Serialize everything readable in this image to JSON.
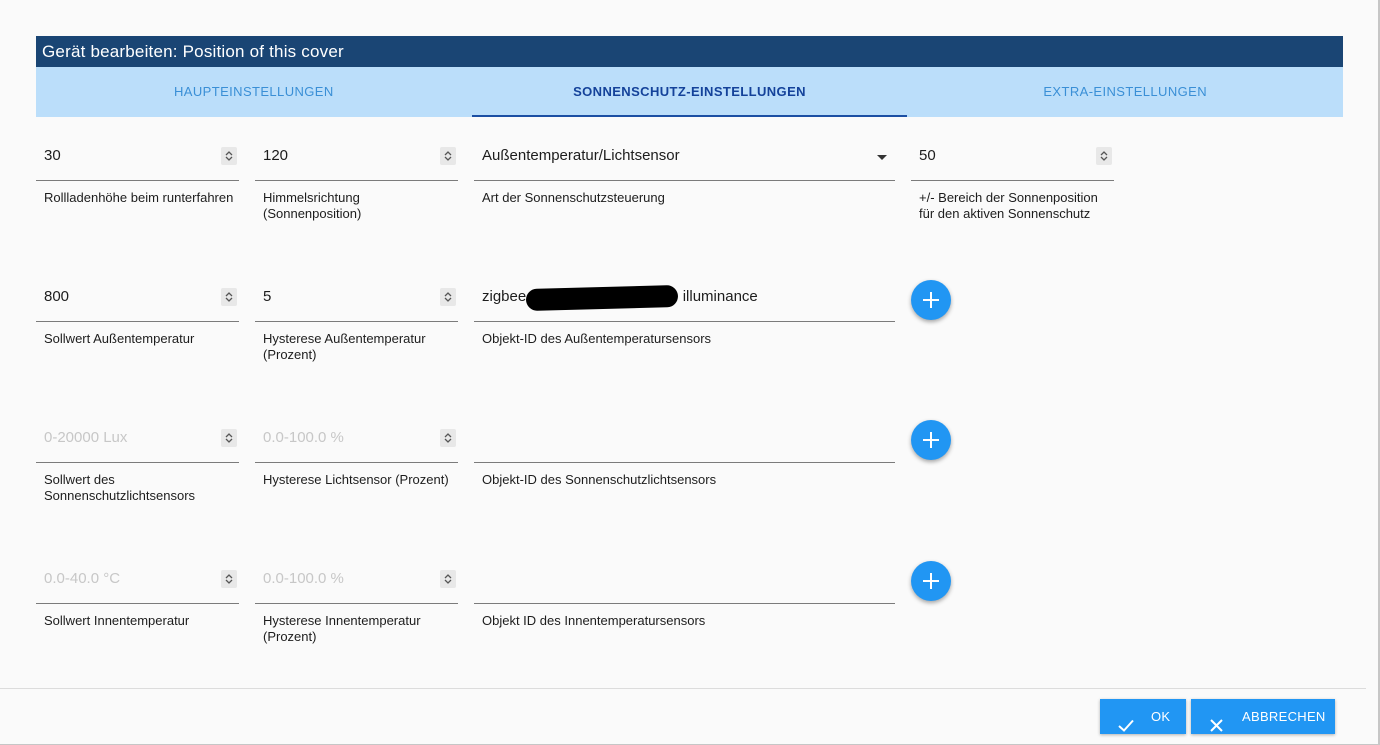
{
  "dialog": {
    "title": "Gerät bearbeiten: Position of this cover"
  },
  "tabs": [
    {
      "label": "HAUPTEINSTELLUNGEN",
      "active": false
    },
    {
      "label": "SONNENSCHUTZ-EINSTELLUNGEN",
      "active": true
    },
    {
      "label": "EXTRA-EINSTELLUNGEN",
      "active": false
    }
  ],
  "fields": {
    "shutter_height": {
      "value": "30",
      "label": "Rollladenhöhe beim runterfahren"
    },
    "sky_direction": {
      "value": "120",
      "label": "Himmelsrichtung (Sonnenposition)"
    },
    "sun_control_type": {
      "value": "Außentemperatur/Lichtsensor",
      "label": "Art der Sonnenschutzsteuerung"
    },
    "sun_range": {
      "value": "50",
      "label": "+/- Bereich der Sonnenposition für den aktiven Sonnenschutz"
    },
    "outside_temp_setpoint": {
      "value": "800",
      "label": "Sollwert Außentemperatur"
    },
    "outside_temp_hysteresis": {
      "value": "5",
      "label": "Hysterese Außentemperatur (Prozent)"
    },
    "outside_temp_sensor": {
      "value_prefix": "zigbee.0",
      "value_suffix": "illuminance",
      "label": "Objekt-ID des Außentemperatursensors"
    },
    "light_sensor_setpoint": {
      "placeholder": "0-20000 Lux",
      "label": "Sollwert des Sonnenschutzlichtsensors"
    },
    "light_sensor_hysteresis": {
      "placeholder": "0.0-100.0 %",
      "label": "Hysterese Lichtsensor (Prozent)"
    },
    "light_sensor_id": {
      "value": "",
      "label": "Objekt-ID des Sonnenschutzlichtsensors"
    },
    "inside_temp_setpoint": {
      "placeholder": "0.0-40.0 °C",
      "label": "Sollwert Innentemperatur"
    },
    "inside_temp_hysteresis": {
      "placeholder": "0.0-100.0 %",
      "label": "Hysterese Innentemperatur (Prozent)"
    },
    "inside_temp_sensor": {
      "value": "",
      "label": "Objekt ID des Innentemperatursensors"
    }
  },
  "buttons": {
    "ok": "OK",
    "cancel": "ABBRECHEN"
  },
  "colors": {
    "title_bg": "#1a4574",
    "tabs_bg": "#bbdefa",
    "accent": "#2196f3",
    "active_tab_text": "#14429a"
  },
  "icons": {
    "add": "plus-icon",
    "ok": "check-icon",
    "cancel": "close-icon",
    "spinner": "spinner-arrows-icon",
    "dropdown": "caret-down-icon"
  }
}
